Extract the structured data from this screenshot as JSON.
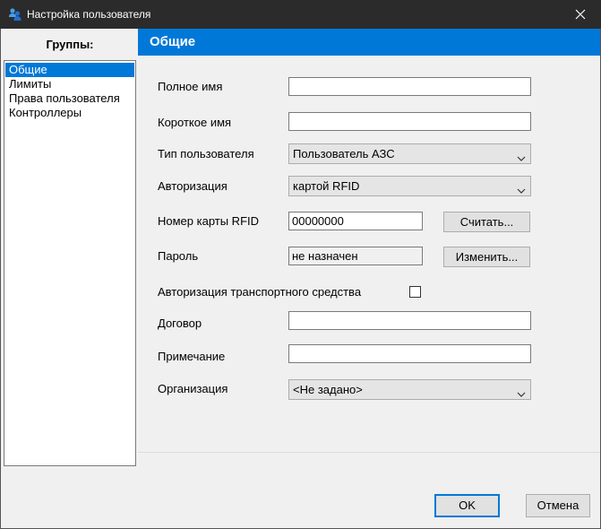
{
  "window": {
    "title": "Настройка пользователя",
    "icon": "users-icon",
    "close_icon": "close-icon"
  },
  "groups": {
    "title": "Группы:",
    "items": [
      {
        "label": "Общие",
        "selected": true
      },
      {
        "label": "Лимиты",
        "selected": false
      },
      {
        "label": "Права пользователя",
        "selected": false
      },
      {
        "label": "Контроллеры",
        "selected": false
      }
    ]
  },
  "section": {
    "title": "Общие"
  },
  "form": {
    "full_name_label": "Полное имя",
    "full_name_value": "",
    "short_name_label": "Короткое имя",
    "short_name_value": "",
    "user_type_label": "Тип пользователя",
    "user_type_value": "Пользователь АЗС",
    "auth_label": "Авторизация",
    "auth_value": "картой RFID",
    "rfid_label": "Номер карты RFID",
    "rfid_value": "00000000",
    "read_button": "Считать...",
    "password_label": "Пароль",
    "password_value": "не назначен",
    "change_button": "Изменить...",
    "vehicle_auth_label": "Авторизация транспортного средства",
    "vehicle_auth_checked": false,
    "contract_label": "Договор",
    "contract_value": "",
    "note_label": "Примечание",
    "note_value": "",
    "org_label": "Организация",
    "org_value": "<Не задано>"
  },
  "buttons": {
    "ok": "OK",
    "cancel": "Отмена"
  },
  "colors": {
    "accent": "#0078d7",
    "titlebar": "#2b2b2b"
  }
}
